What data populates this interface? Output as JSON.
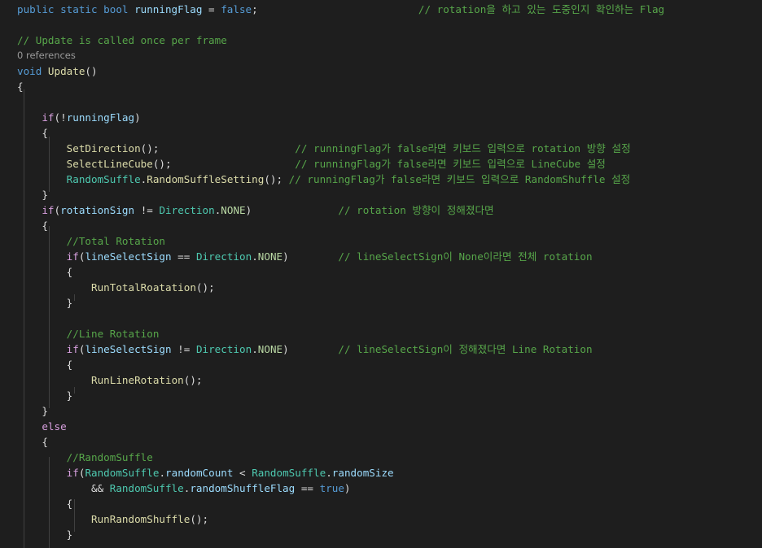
{
  "editor": {
    "colors": {
      "background": "#1e1e1e",
      "keyword": "#569cd6",
      "control_keyword": "#d8a0df",
      "method": "#dcdcaa",
      "type": "#4ec9b0",
      "field": "#9cdcfe",
      "comment": "#57a64a",
      "enum_member": "#b8d7a3",
      "codelens": "#999999",
      "indent_guide": "#404040"
    },
    "lines": [
      {
        "kind": "code",
        "tokens": [
          [
            "kw",
            "public static bool "
          ],
          [
            "pv",
            "runningFlag"
          ],
          [
            "pl",
            " = "
          ],
          [
            "kw",
            "false"
          ],
          [
            "pl",
            ";"
          ],
          [
            "pl",
            "                          "
          ],
          [
            "co",
            "// rotation을 하고 있는 도중인지 확인하는 Flag"
          ]
        ]
      },
      {
        "kind": "code",
        "tokens": []
      },
      {
        "kind": "code",
        "tokens": [
          [
            "co",
            "// Update is called once per frame"
          ]
        ]
      },
      {
        "kind": "codelens",
        "text": "0 references"
      },
      {
        "kind": "code",
        "tokens": [
          [
            "kw",
            "void "
          ],
          [
            "fn",
            "Update"
          ],
          [
            "pl",
            "()"
          ]
        ]
      },
      {
        "kind": "code",
        "tokens": [
          [
            "pl",
            "{"
          ]
        ]
      },
      {
        "kind": "code",
        "tokens": []
      },
      {
        "kind": "code",
        "tokens": [
          [
            "pl",
            "    "
          ],
          [
            "ctl",
            "if"
          ],
          [
            "pl",
            "(!"
          ],
          [
            "pv",
            "runningFlag"
          ],
          [
            "pl",
            ")"
          ]
        ]
      },
      {
        "kind": "code",
        "tokens": [
          [
            "pl",
            "    {"
          ]
        ]
      },
      {
        "kind": "code",
        "tokens": [
          [
            "pl",
            "        "
          ],
          [
            "fn",
            "SetDirection"
          ],
          [
            "pl",
            "();"
          ],
          [
            "pl",
            "                      "
          ],
          [
            "co",
            "// runningFlag가 false라면 키보드 입력으로 rotation 방향 설정"
          ]
        ]
      },
      {
        "kind": "code",
        "tokens": [
          [
            "pl",
            "        "
          ],
          [
            "fn",
            "SelectLineCube"
          ],
          [
            "pl",
            "();"
          ],
          [
            "pl",
            "                    "
          ],
          [
            "co",
            "// runningFlag가 false라면 키보드 입력으로 LineCube 설정"
          ]
        ]
      },
      {
        "kind": "code",
        "tokens": [
          [
            "pl",
            "        "
          ],
          [
            "ty",
            "RandomSuffle"
          ],
          [
            "pl",
            "."
          ],
          [
            "fn",
            "RandomSuffleSetting"
          ],
          [
            "pl",
            "(); "
          ],
          [
            "co",
            "// runningFlag가 false라면 키보드 입력으로 RandomShuffle 설정"
          ]
        ]
      },
      {
        "kind": "code",
        "tokens": [
          [
            "pl",
            "    }"
          ]
        ]
      },
      {
        "kind": "code",
        "tokens": [
          [
            "pl",
            "    "
          ],
          [
            "ctl",
            "if"
          ],
          [
            "pl",
            "("
          ],
          [
            "pv",
            "rotationSign"
          ],
          [
            "pl",
            " != "
          ],
          [
            "ty",
            "Direction"
          ],
          [
            "pl",
            "."
          ],
          [
            "en",
            "NONE"
          ],
          [
            "pl",
            ")"
          ],
          [
            "pl",
            "              "
          ],
          [
            "co",
            "// rotation 방향이 정해졌다면"
          ]
        ]
      },
      {
        "kind": "code",
        "tokens": [
          [
            "pl",
            "    {"
          ]
        ]
      },
      {
        "kind": "code",
        "tokens": [
          [
            "pl",
            "        "
          ],
          [
            "co",
            "//Total Rotation"
          ]
        ]
      },
      {
        "kind": "code",
        "tokens": [
          [
            "pl",
            "        "
          ],
          [
            "ctl",
            "if"
          ],
          [
            "pl",
            "("
          ],
          [
            "pv",
            "lineSelectSign"
          ],
          [
            "pl",
            " == "
          ],
          [
            "ty",
            "Direction"
          ],
          [
            "pl",
            "."
          ],
          [
            "en",
            "NONE"
          ],
          [
            "pl",
            ")"
          ],
          [
            "pl",
            "        "
          ],
          [
            "co",
            "// lineSelectSign이 None이라면 전체 rotation"
          ]
        ]
      },
      {
        "kind": "code",
        "tokens": [
          [
            "pl",
            "        {"
          ]
        ]
      },
      {
        "kind": "code",
        "tokens": [
          [
            "pl",
            "            "
          ],
          [
            "fn",
            "RunTotalRoatation"
          ],
          [
            "pl",
            "();"
          ]
        ]
      },
      {
        "kind": "code",
        "tokens": [
          [
            "pl",
            "        }"
          ]
        ]
      },
      {
        "kind": "code",
        "tokens": []
      },
      {
        "kind": "code",
        "tokens": [
          [
            "pl",
            "        "
          ],
          [
            "co",
            "//Line Rotation"
          ]
        ]
      },
      {
        "kind": "code",
        "tokens": [
          [
            "pl",
            "        "
          ],
          [
            "ctl",
            "if"
          ],
          [
            "pl",
            "("
          ],
          [
            "pv",
            "lineSelectSign"
          ],
          [
            "pl",
            " != "
          ],
          [
            "ty",
            "Direction"
          ],
          [
            "pl",
            "."
          ],
          [
            "en",
            "NONE"
          ],
          [
            "pl",
            ")"
          ],
          [
            "pl",
            "        "
          ],
          [
            "co",
            "// lineSelectSign이 정해졌다면 Line Rotation"
          ]
        ]
      },
      {
        "kind": "code",
        "tokens": [
          [
            "pl",
            "        {"
          ]
        ]
      },
      {
        "kind": "code",
        "tokens": [
          [
            "pl",
            "            "
          ],
          [
            "fn",
            "RunLineRotation"
          ],
          [
            "pl",
            "();"
          ]
        ]
      },
      {
        "kind": "code",
        "tokens": [
          [
            "pl",
            "        }"
          ]
        ]
      },
      {
        "kind": "code",
        "tokens": [
          [
            "pl",
            "    }"
          ]
        ]
      },
      {
        "kind": "code",
        "tokens": [
          [
            "pl",
            "    "
          ],
          [
            "ctl",
            "else"
          ]
        ]
      },
      {
        "kind": "code",
        "tokens": [
          [
            "pl",
            "    {"
          ]
        ]
      },
      {
        "kind": "code",
        "tokens": [
          [
            "pl",
            "        "
          ],
          [
            "co",
            "//RandomSuffle"
          ]
        ]
      },
      {
        "kind": "code",
        "tokens": [
          [
            "pl",
            "        "
          ],
          [
            "ctl",
            "if"
          ],
          [
            "pl",
            "("
          ],
          [
            "ty",
            "RandomSuffle"
          ],
          [
            "pl",
            "."
          ],
          [
            "pv",
            "randomCount"
          ],
          [
            "pl",
            " < "
          ],
          [
            "ty",
            "RandomSuffle"
          ],
          [
            "pl",
            "."
          ],
          [
            "pv",
            "randomSize"
          ]
        ]
      },
      {
        "kind": "code",
        "tokens": [
          [
            "pl",
            "            && "
          ],
          [
            "ty",
            "RandomSuffle"
          ],
          [
            "pl",
            "."
          ],
          [
            "pv",
            "randomShuffleFlag"
          ],
          [
            "pl",
            " == "
          ],
          [
            "kw",
            "true"
          ],
          [
            "pl",
            ")"
          ]
        ]
      },
      {
        "kind": "code",
        "tokens": [
          [
            "pl",
            "        {"
          ]
        ]
      },
      {
        "kind": "code",
        "tokens": [
          [
            "pl",
            "            "
          ],
          [
            "fn",
            "RunRandomShuffle"
          ],
          [
            "pl",
            "();"
          ]
        ]
      },
      {
        "kind": "code",
        "tokens": [
          [
            "pl",
            "        }"
          ]
        ]
      },
      {
        "kind": "code",
        "tokens": []
      }
    ]
  }
}
